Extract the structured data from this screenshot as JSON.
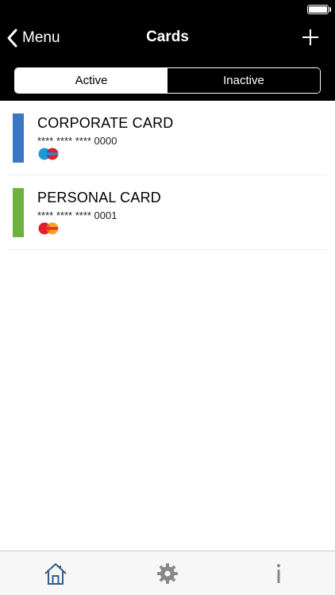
{
  "header": {
    "back_label": "Menu",
    "title": "Cards",
    "add_icon": "plus-icon"
  },
  "segments": [
    {
      "label": "Active",
      "selected": true
    },
    {
      "label": "Inactive",
      "selected": false
    }
  ],
  "cards": [
    {
      "name": "CORPORATE CARD",
      "number": "**** **** **** 0000",
      "color": "#3a78c4",
      "brand": "Maestro"
    },
    {
      "name": "PERSONAL CARD",
      "number": "**** **** **** 0001",
      "color": "#6cb33e",
      "brand": "MasterCard"
    }
  ],
  "tabbar": {
    "items": [
      {
        "icon": "home-icon"
      },
      {
        "icon": "gear-icon"
      },
      {
        "icon": "info-icon"
      }
    ]
  },
  "colors": {
    "header_bg": "#000000",
    "tabbar_icon": "#2f5d8a"
  }
}
